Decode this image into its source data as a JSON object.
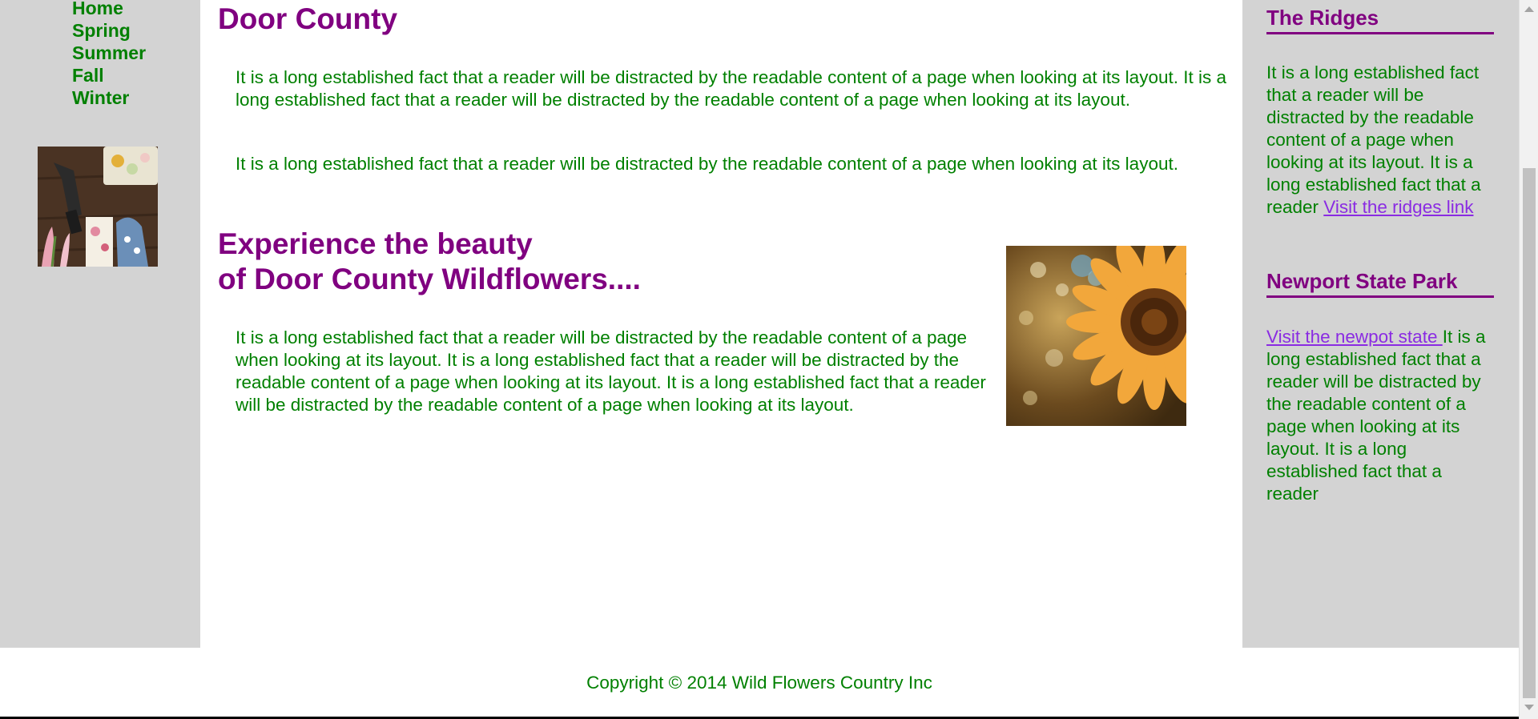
{
  "nav": {
    "items": [
      {
        "label": "Home"
      },
      {
        "label": "Spring"
      },
      {
        "label": "Summer"
      },
      {
        "label": "Fall"
      },
      {
        "label": "Winter"
      }
    ]
  },
  "main": {
    "title": "Door County",
    "paragraphs": [
      "It is a long established fact that a reader will be distracted by the readable content of a page when looking at its layout. It is a long established fact that a reader will be distracted by the readable content of a page when looking at its layout.",
      "It is a long established fact that a reader will be distracted by the readable content of a page when looking at its layout."
    ],
    "subtitle_line1": "Experience the beauty",
    "subtitle_line2": "of Door County Wildflowers....",
    "wildflower_paragraph": "It is a long established fact that a reader will be distracted by the readable content of a page when looking at its layout. It is a long established fact that a reader will be distracted by the readable content of a page when looking at its layout. It is a long established fact that a reader will be distracted by the readable content of a page when looking at its layout."
  },
  "sidebar": {
    "ridges": {
      "heading": "The Ridges",
      "text": "It is a long established fact that a reader will be distracted by the readable content of a page when looking at its layout. It is a long established fact that a reader ",
      "link": "Visit the ridges link"
    },
    "newport": {
      "heading": "Newport State Park",
      "link": "Visit the newpot state ",
      "text": "It is a long established fact that a reader will be distracted by the readable content of a page when looking at its layout. It is a long established fact that a reader"
    }
  },
  "footer": {
    "copyright": "Copyright © 2014 Wild Flowers Country Inc"
  },
  "colors": {
    "sidebar_bg": "#d3d3d3",
    "heading": "#800080",
    "text": "#008000",
    "link": "#8a2be2"
  }
}
